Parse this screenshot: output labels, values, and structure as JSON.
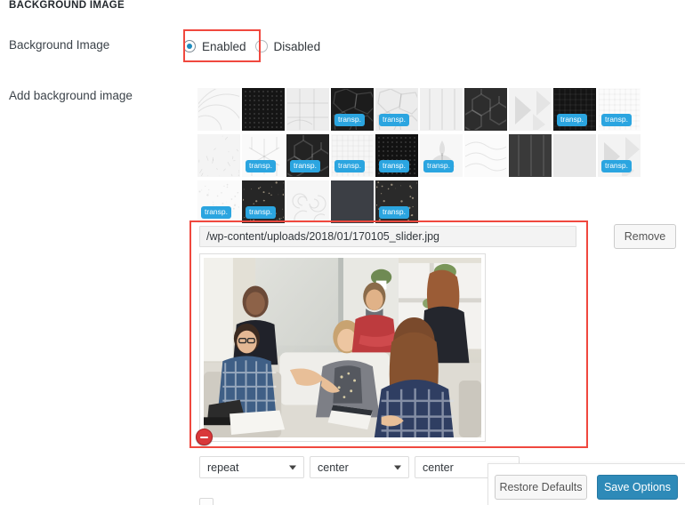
{
  "section": {
    "title": "BACKGROUND IMAGE"
  },
  "fields": {
    "background_image_label": "Background Image",
    "add_background_image_label": "Add background image"
  },
  "radio_group": {
    "name": "background-image-toggle",
    "selected": "Enabled",
    "options": [
      {
        "label": "Enabled",
        "checked": true
      },
      {
        "label": "Disabled",
        "checked": false
      }
    ],
    "highlight_color": "#f0483e"
  },
  "thumbnails": {
    "transparent_tag_label": "transp.",
    "tag_color": "#2ba5e0",
    "rows": [
      [
        {
          "id": "pattern-01",
          "bg": "#f7f7f7",
          "dark": false,
          "transp": false,
          "pattern": "arcs"
        },
        {
          "id": "pattern-02",
          "bg": "#151515",
          "dark": true,
          "transp": false,
          "pattern": "dots"
        },
        {
          "id": "pattern-03",
          "bg": "#ededed",
          "dark": false,
          "transp": false,
          "pattern": "lines"
        },
        {
          "id": "pattern-04",
          "bg": "#1c1c1c",
          "dark": true,
          "transp": true,
          "pattern": "cells"
        },
        {
          "id": "pattern-05",
          "bg": "#ececec",
          "dark": false,
          "transp": true,
          "pattern": "cells"
        },
        {
          "id": "pattern-06",
          "bg": "#f0f0f0",
          "dark": false,
          "transp": false,
          "pattern": "vstripe"
        },
        {
          "id": "pattern-07",
          "bg": "#2d2d2d",
          "dark": true,
          "transp": false,
          "pattern": "cube"
        },
        {
          "id": "pattern-08",
          "bg": "#f2f2f2",
          "dark": false,
          "transp": false,
          "pattern": "tri"
        },
        {
          "id": "pattern-09",
          "bg": "#141414",
          "dark": true,
          "transp": true,
          "pattern": "grid"
        },
        {
          "id": "pattern-10",
          "bg": "#fbfbfb",
          "dark": false,
          "transp": true,
          "pattern": "grid"
        }
      ],
      [
        {
          "id": "pattern-11",
          "bg": "#f4f4f4",
          "dark": false,
          "transp": false,
          "pattern": "paper"
        },
        {
          "id": "pattern-12",
          "bg": "#fafafa",
          "dark": false,
          "transp": true,
          "pattern": "star"
        },
        {
          "id": "pattern-13",
          "bg": "#232323",
          "dark": true,
          "transp": true,
          "pattern": "cube"
        },
        {
          "id": "pattern-14",
          "bg": "#f6f6f6",
          "dark": false,
          "transp": true,
          "pattern": "grid"
        },
        {
          "id": "pattern-15",
          "bg": "#121212",
          "dark": true,
          "transp": true,
          "pattern": "dots"
        },
        {
          "id": "pattern-16",
          "bg": "#f7f7f7",
          "dark": false,
          "transp": true,
          "pattern": "fleur"
        },
        {
          "id": "pattern-17",
          "bg": "#fbfbfb",
          "dark": false,
          "transp": false,
          "pattern": "wave"
        },
        {
          "id": "pattern-18",
          "bg": "#3a3a3a",
          "dark": true,
          "transp": false,
          "pattern": "vstripe"
        },
        {
          "id": "pattern-19",
          "bg": "#e8e8e8",
          "dark": false,
          "transp": false,
          "pattern": "plain"
        },
        {
          "id": "pattern-20",
          "bg": "#f3f3f3",
          "dark": false,
          "transp": true,
          "pattern": "tri"
        }
      ],
      [
        {
          "id": "pattern-21",
          "bg": "#fafafa",
          "dark": false,
          "transp": true,
          "pattern": "speck"
        },
        {
          "id": "pattern-22",
          "bg": "#262626",
          "dark": true,
          "transp": true,
          "pattern": "speck"
        },
        {
          "id": "pattern-23",
          "bg": "#f6f6f6",
          "dark": false,
          "transp": false,
          "pattern": "swirl"
        },
        {
          "id": "pattern-24",
          "bg": "#3c3f45",
          "dark": true,
          "transp": false,
          "pattern": "plain"
        },
        {
          "id": "pattern-25",
          "bg": "#2a2a2a",
          "dark": true,
          "transp": true,
          "pattern": "speck"
        }
      ]
    ]
  },
  "selected_image": {
    "path": "/wp-content/uploads/2018/01/170105_slider.jpg",
    "preview_alt": "office meeting photo",
    "remove_badge_icon": "minus-circle-icon",
    "highlight_color": "#f0483e"
  },
  "buttons": {
    "remove": "Remove",
    "restore_defaults": "Restore Defaults",
    "save_options": "Save Options",
    "save_color": "#2e8ab8"
  },
  "selects": [
    {
      "name": "background-repeat",
      "value": "repeat",
      "icon": "chevron-down-icon"
    },
    {
      "name": "background-position-x",
      "value": "center",
      "icon": "chevron-down-icon"
    },
    {
      "name": "background-position-y",
      "value": "center",
      "icon": "chevron-down-icon"
    }
  ]
}
